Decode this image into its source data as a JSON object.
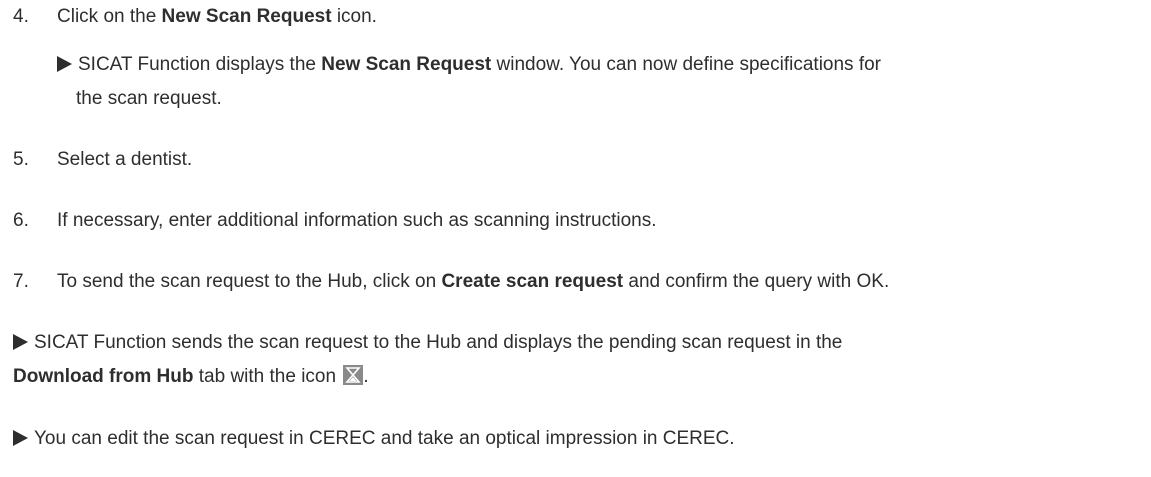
{
  "steps": [
    {
      "number": "4.",
      "parts": [
        "Click on the ",
        "New Scan Request",
        " icon."
      ],
      "result": {
        "line1_parts": [
          "SICAT Function displays the ",
          "New Scan Request",
          " window. You can now define specifications for"
        ],
        "line2": "the scan request."
      }
    },
    {
      "number": "5.",
      "text": "Select a dentist."
    },
    {
      "number": "6.",
      "text": "If necessary, enter additional information such as scanning instructions."
    },
    {
      "number": "7.",
      "parts": [
        "To send the scan request to the Hub, click on ",
        "Create scan request",
        " and confirm the query with OK."
      ]
    }
  ],
  "results": [
    {
      "line1": "SICAT Function sends the scan request to the Hub and displays the pending scan request in the",
      "line2_parts": [
        "Download from Hub",
        " tab with the icon ",
        "."
      ],
      "icon": "hourglass-icon"
    },
    {
      "line1": "You can edit the scan request in CEREC and take an optical impression in CEREC."
    }
  ]
}
